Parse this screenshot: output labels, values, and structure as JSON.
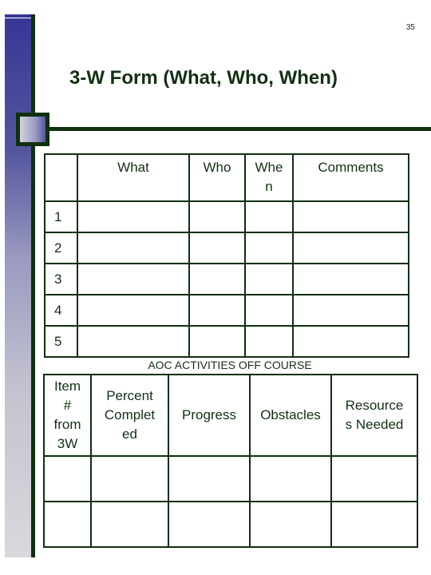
{
  "page_number": "35",
  "title": "3-W Form (What, Who, When)",
  "form_3w": {
    "headers": [
      "",
      "What",
      "Who",
      "Whe n",
      "Comments"
    ],
    "header_lines": [
      [
        ""
      ],
      [
        "What"
      ],
      [
        "Who"
      ],
      [
        "Whe",
        "n"
      ],
      [
        "Comments"
      ]
    ],
    "rows": [
      {
        "num": "1",
        "what": "",
        "who": "",
        "when": "",
        "comments": ""
      },
      {
        "num": "2",
        "what": "",
        "who": "",
        "when": "",
        "comments": ""
      },
      {
        "num": "3",
        "what": "",
        "who": "",
        "when": "",
        "comments": ""
      },
      {
        "num": "4",
        "what": "",
        "who": "",
        "when": "",
        "comments": ""
      },
      {
        "num": "5",
        "what": "",
        "who": "",
        "when": "",
        "comments": ""
      }
    ]
  },
  "aoc_caption": "AOC ACTIVITIES OFF COURSE",
  "aoc_table": {
    "header_lines": [
      [
        "Item",
        "#",
        "from",
        "3W"
      ],
      [
        "Percent",
        "Complet",
        "ed"
      ],
      [
        "Progress"
      ],
      [
        "Obstacles"
      ],
      [
        "Resource",
        "s Needed"
      ]
    ],
    "rows": [
      {
        "item": "",
        "percent": "",
        "progress": "",
        "obstacles": "",
        "resources": ""
      },
      {
        "item": "",
        "percent": "",
        "progress": "",
        "obstacles": "",
        "resources": ""
      }
    ]
  }
}
